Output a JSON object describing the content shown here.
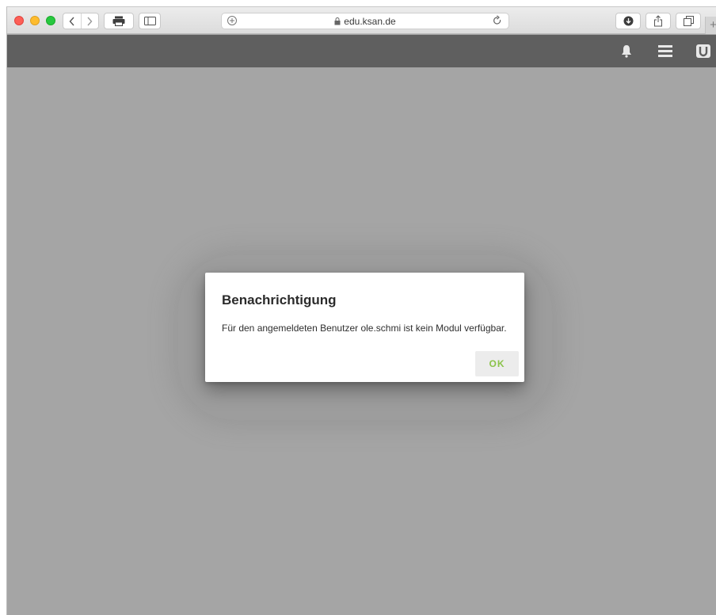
{
  "browser": {
    "address": "edu.ksan.de",
    "new_tab_label": "+"
  },
  "header": {
    "icons": [
      "bell-icon",
      "menu-icon",
      "user-icon"
    ],
    "background": "#5f5f5f"
  },
  "dialog": {
    "title": "Benachrichtigung",
    "message": "Für den angemeldeten Benutzer ole.schmi ist kein Modul verfügbar.",
    "ok_label": "OK",
    "accent": "#8bc34a"
  }
}
